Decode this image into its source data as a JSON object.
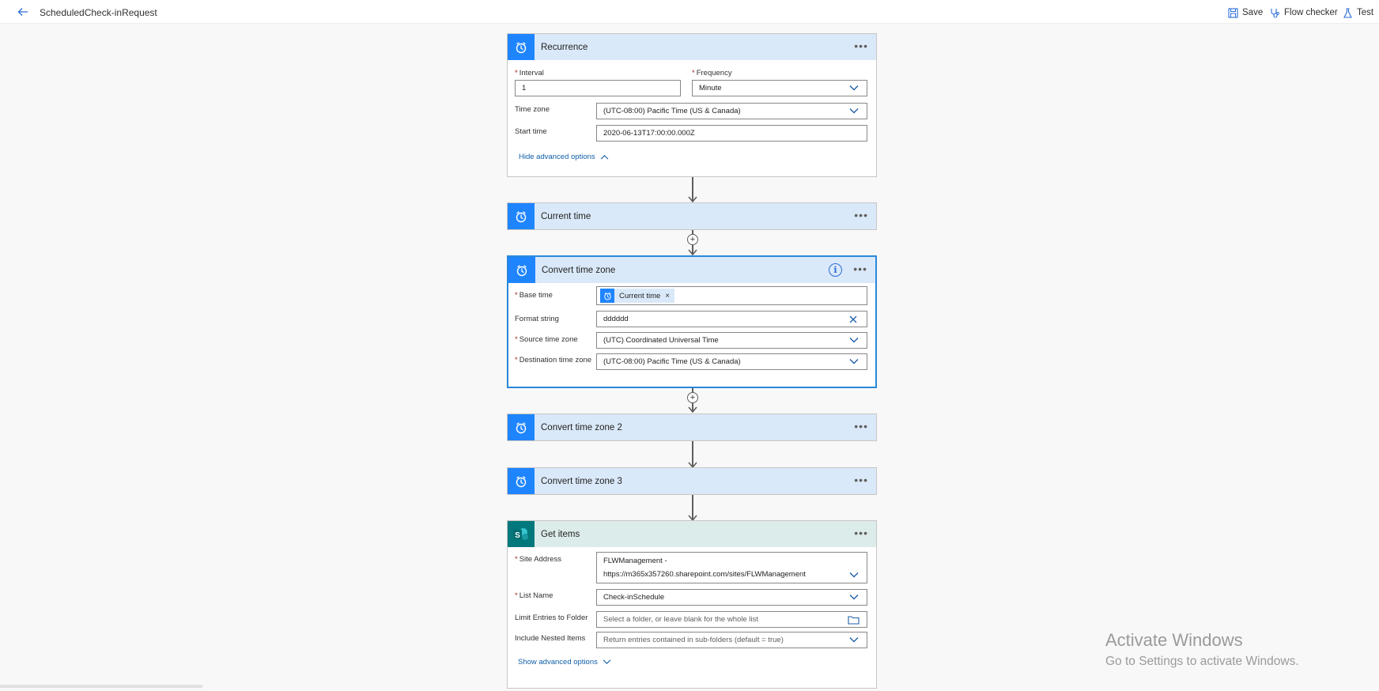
{
  "header": {
    "flow_title": "ScheduledCheck-inRequest",
    "save_label": "Save",
    "flow_checker_label": "Flow checker",
    "test_label": "Test"
  },
  "recurrence": {
    "title": "Recurrence",
    "interval_label": "Interval",
    "interval_value": "1",
    "frequency_label": "Frequency",
    "frequency_value": "Minute",
    "timezone_label": "Time zone",
    "timezone_value": "(UTC-08:00) Pacific Time (US & Canada)",
    "start_label": "Start time",
    "start_value": "2020-06-13T17:00:00.000Z",
    "advanced_link": "Hide advanced options"
  },
  "current_time": {
    "title": "Current time"
  },
  "convert_tz": {
    "title": "Convert time zone",
    "base_label": "Base time",
    "base_token": "Current time",
    "format_label": "Format string",
    "format_value": "dddddd",
    "source_label": "Source time zone",
    "source_value": "(UTC) Coordinated Universal Time",
    "dest_label": "Destination time zone",
    "dest_value": "(UTC-08:00) Pacific Time (US & Canada)"
  },
  "convert_tz2": {
    "title": "Convert time zone 2"
  },
  "convert_tz3": {
    "title": "Convert time zone 3"
  },
  "get_items": {
    "title": "Get items",
    "icon_letter": "S",
    "site_label": "Site Address",
    "site_value_line1": "FLWManagement -",
    "site_value_line2": "https://m365x357260.sharepoint.com/sites/FLWManagement",
    "list_label": "List Name",
    "list_value": "Check-inSchedule",
    "folder_label": "Limit Entries to Folder",
    "folder_placeholder": "Select a folder, or leave blank for the whole list",
    "nested_label": "Include Nested Items",
    "nested_placeholder": "Return entries contained in sub-folders (default = true)",
    "advanced_link": "Show advanced options"
  },
  "watermark": {
    "line1": "Activate Windows",
    "line2": "Go to Settings to activate Windows."
  },
  "colors": {
    "accent": "#1f85ff",
    "sharepoint": "#03787c",
    "header_bg": "#dae9f9",
    "link": "#0f5ea8"
  }
}
